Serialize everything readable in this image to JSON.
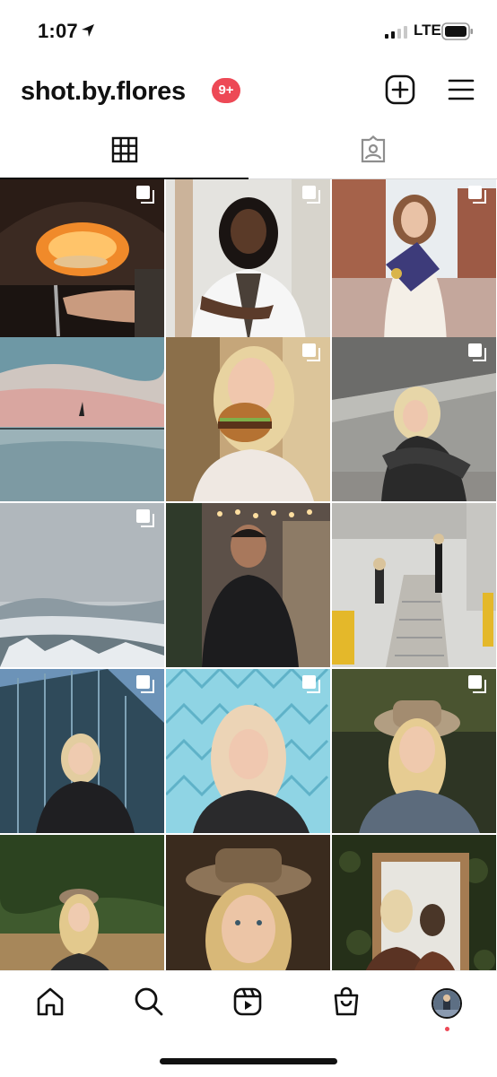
{
  "status_bar": {
    "time": "1:07",
    "network": "LTE",
    "icons": [
      "location-arrow-icon",
      "signal-icon",
      "battery-icon"
    ]
  },
  "header": {
    "username": "shot.by.flores",
    "notification_badge": "9+",
    "icons": [
      "add-post-icon",
      "menu-icon"
    ]
  },
  "tabs": [
    {
      "name": "posts-grid",
      "icon": "grid-icon",
      "selected": true
    },
    {
      "name": "tagged",
      "icon": "tagged-icon",
      "selected": false
    }
  ],
  "grid": {
    "posts": [
      {
        "subject": "pizza oven",
        "multi": true
      },
      {
        "subject": "doctor in white coat",
        "multi": true
      },
      {
        "subject": "graduate with cap",
        "multi": true
      },
      {
        "subject": "sea and sailboat",
        "multi": false
      },
      {
        "subject": "woman holding burger",
        "multi": true
      },
      {
        "subject": "woman under overpass",
        "multi": true
      },
      {
        "subject": "snowy mountain landscape",
        "multi": true
      },
      {
        "subject": "man seated indoors",
        "multi": false
      },
      {
        "subject": "couple on stairs",
        "multi": false
      },
      {
        "subject": "woman by glass building",
        "multi": true
      },
      {
        "subject": "woman by blue fence",
        "multi": true
      },
      {
        "subject": "woman in hat",
        "multi": true
      },
      {
        "subject": "woman in field",
        "multi": false
      },
      {
        "subject": "woman in hat close-up",
        "multi": false
      },
      {
        "subject": "women at mirror",
        "multi": false
      }
    ]
  },
  "bottom_nav": {
    "items": [
      "home-icon",
      "search-icon",
      "reels-icon",
      "shop-icon",
      "profile-avatar"
    ],
    "accent": "#ed4956"
  }
}
